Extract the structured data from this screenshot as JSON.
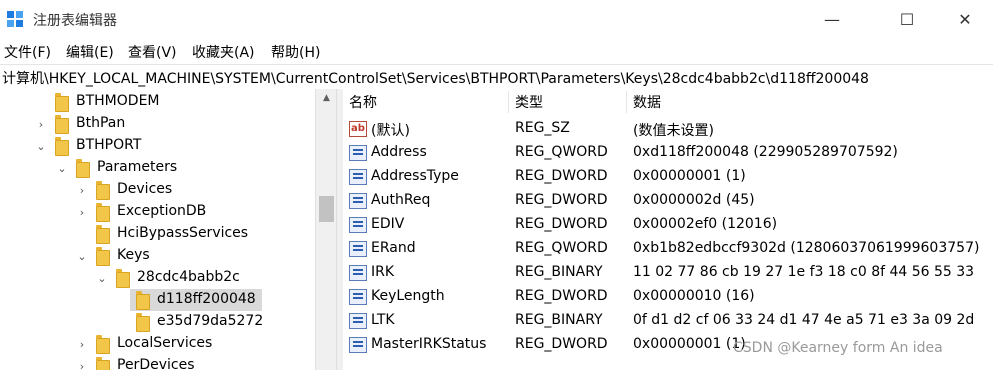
{
  "window": {
    "title": "注册表编辑器",
    "controls": {
      "minimize": "—",
      "maximize": "☐",
      "close": "✕"
    }
  },
  "menu": [
    "文件(F)",
    "编辑(E)",
    "查看(V)",
    "收藏夹(A)",
    "帮助(H)"
  ],
  "address": "计算机\\HKEY_LOCAL_MACHINE\\SYSTEM\\CurrentControlSet\\Services\\BTHPORT\\Parameters\\Keys\\28cdc4babb2c\\d118ff200048",
  "tree": [
    {
      "label": "BTHMODEM",
      "expander": ""
    },
    {
      "label": "BthPan",
      "expander": "›"
    },
    {
      "label": "BTHPORT",
      "expander": "⌄"
    },
    {
      "label": "Parameters",
      "expander": "⌄"
    },
    {
      "label": "Devices",
      "expander": "›"
    },
    {
      "label": "ExceptionDB",
      "expander": "›"
    },
    {
      "label": "HciBypassServices",
      "expander": ""
    },
    {
      "label": "Keys",
      "expander": "⌄"
    },
    {
      "label": "28cdc4babb2c",
      "expander": "⌄"
    },
    {
      "label": "d118ff200048",
      "expander": ""
    },
    {
      "label": "e35d79da5272",
      "expander": ""
    },
    {
      "label": "LocalServices",
      "expander": "›"
    },
    {
      "label": "PerDevices",
      "expander": "›"
    }
  ],
  "columns": {
    "name": "名称",
    "type": "类型",
    "data": "数据"
  },
  "values": [
    {
      "name": "(默认)",
      "type": "REG_SZ",
      "data": "(数值未设置)",
      "icon": "string-value-icon"
    },
    {
      "name": "Address",
      "type": "REG_QWORD",
      "data": "0xd118ff200048 (229905289707592)",
      "icon": "binary-value-icon"
    },
    {
      "name": "AddressType",
      "type": "REG_DWORD",
      "data": "0x00000001 (1)",
      "icon": "binary-value-icon"
    },
    {
      "name": "AuthReq",
      "type": "REG_DWORD",
      "data": "0x0000002d (45)",
      "icon": "binary-value-icon"
    },
    {
      "name": "EDIV",
      "type": "REG_DWORD",
      "data": "0x00002ef0 (12016)",
      "icon": "binary-value-icon"
    },
    {
      "name": "ERand",
      "type": "REG_QWORD",
      "data": "0xb1b82edbccf9302d (12806037061999603757)",
      "icon": "binary-value-icon"
    },
    {
      "name": "IRK",
      "type": "REG_BINARY",
      "data": "11 02 77 86 cb 19 27 1e f3 18 c0 8f 44 56 55 33",
      "icon": "binary-value-icon"
    },
    {
      "name": "KeyLength",
      "type": "REG_DWORD",
      "data": "0x00000010 (16)",
      "icon": "binary-value-icon"
    },
    {
      "name": "LTK",
      "type": "REG_BINARY",
      "data": "0f d1 d2 cf 06 33 24 d1 47 4e a5 71 e3 3a 09 2d",
      "icon": "binary-value-icon"
    },
    {
      "name": "MasterIRKStatus",
      "type": "REG_DWORD",
      "data": "0x00000001 (1)",
      "icon": "binary-value-icon"
    }
  ],
  "watermark": "CSDN @Kearney form An idea"
}
